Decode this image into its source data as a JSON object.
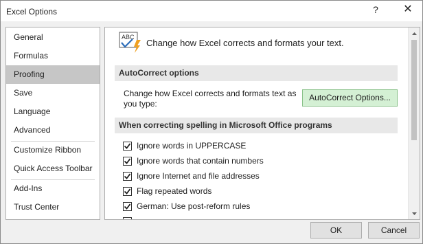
{
  "window": {
    "title": "Excel Options",
    "help_label": "?",
    "close_label": "✕"
  },
  "nav": {
    "items": [
      {
        "label": "General"
      },
      {
        "label": "Formulas"
      },
      {
        "label": "Proofing",
        "selected": true
      },
      {
        "label": "Save"
      },
      {
        "label": "Language"
      },
      {
        "label": "Advanced"
      },
      {
        "label": "Customize Ribbon"
      },
      {
        "label": "Quick Access Toolbar"
      },
      {
        "label": "Add-Ins"
      },
      {
        "label": "Trust Center"
      }
    ]
  },
  "content": {
    "header_icon_text": "ABC",
    "header": "Change how Excel corrects and formats your text.",
    "autocorrect": {
      "section_title": "AutoCorrect options",
      "label": "Change how Excel corrects and formats text as you type:",
      "button_label": "AutoCorrect Options..."
    },
    "spelling": {
      "section_title": "When correcting spelling in Microsoft Office programs",
      "options": [
        {
          "label": "Ignore words in UPPERCASE",
          "checked": true
        },
        {
          "label": "Ignore words that contain numbers",
          "checked": true
        },
        {
          "label": "Ignore Internet and file addresses",
          "checked": true
        },
        {
          "label": "Flag repeated words",
          "checked": true
        },
        {
          "label": "German: Use post-reform rules",
          "checked": true
        }
      ]
    }
  },
  "buttons": {
    "ok": "OK",
    "cancel": "Cancel"
  },
  "colors": {
    "selected_nav": "#c6c6c6",
    "section_band": "#e8e8e8",
    "autocorrect_button": "#d4f0d4"
  }
}
